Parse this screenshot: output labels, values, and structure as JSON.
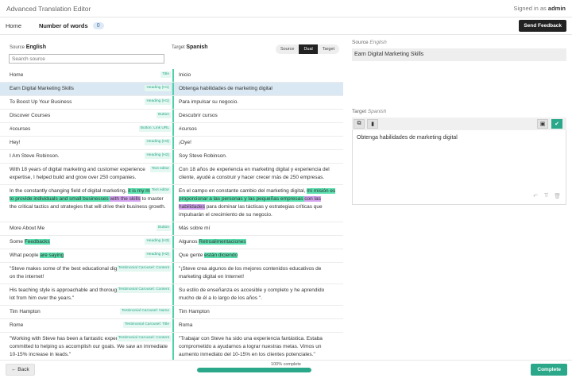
{
  "app": {
    "title": "Advanced Translation Editor",
    "signed_prefix": "Signed in as ",
    "user": "admin"
  },
  "nav": {
    "home": "Home",
    "words_label": "Number of words",
    "words_count": "0",
    "feedback": "Send Feedback"
  },
  "source": {
    "label": "Source",
    "language": "English",
    "search_placeholder": "Search source"
  },
  "target": {
    "label": "Target",
    "language": "Spanish"
  },
  "view_toggle": {
    "options": [
      "Source",
      "Dual",
      "Target"
    ],
    "selected": "Dual"
  },
  "rows": [
    {
      "src": "Home",
      "tag": "Title",
      "tgt": "Inicio"
    },
    {
      "src": "Earn Digital Marketing Skills",
      "tag": "Heading (H1)",
      "tgt": "Obtenga habilidades de marketing digital",
      "selected": true
    },
    {
      "src": "To Boost Up Your Business",
      "tag": "Heading (H1)",
      "tgt": "Para impulsar su negocio."
    },
    {
      "src": "Discover Courses",
      "tag": "Button",
      "tgt": "Descubrir cursos"
    },
    {
      "src": "#courses",
      "tag": "Button: Link URL",
      "tgt": "#cursos"
    },
    {
      "src": "Hey!",
      "tag": "Heading (H3)",
      "tgt": "¡Oye!"
    },
    {
      "src": "I Am Steve Robinson.",
      "tag": "Heading (H2)",
      "tgt": "Soy Steve Robinson."
    },
    {
      "src": "With 18 years of digital marketing and customer experience expertise, I helped build and grow over 250 companies.",
      "tag": "Text editor",
      "tgt": "Con 18 años de experiencia en marketing digital y experiencia del cliente, ayudé a construir y hacer crecer más de 250 empresas."
    },
    {
      "src_parts": [
        "In the constantly changing field of digital marketing, ",
        "it is my mission to provide individuals and small businesses ",
        "with the skills",
        " to master the critical tactics and strategies that will drive their business growth."
      ],
      "tag": "Text editor",
      "tgt_parts": [
        "En el campo en constante cambio del marketing digital, ",
        "mi misión es proporcionar a las personas y las pequeñas empresas ",
        "con las habilidades",
        " para dominar las tácticas y estrategias críticas que impulsarán el crecimiento de su negocio."
      ]
    },
    {
      "src": "More About Me",
      "tag": "Button",
      "tgt": "Más sobre mí"
    },
    {
      "src_parts": [
        "Some ",
        "Feedbacks"
      ],
      "tag": "Heading (H3)",
      "tgt_parts": [
        "Algunos ",
        "Retroalimentaciones"
      ]
    },
    {
      "src_parts": [
        "What people ",
        "are saying"
      ],
      "tag": "Heading (H2)",
      "tgt_parts": [
        "Que gente ",
        "están diciendo"
      ]
    },
    {
      "src": "\"Steve makes some of the best educational digital marketing content on the internet!",
      "tag": "Testimonial Carousel: Content",
      "tgt": "\"¡Steve crea algunos de los mejores contenidos educativos de marketing digital en Internet!"
    },
    {
      "src": "His teaching style is approachable and thorough and I've learned a lot from him over the years.\"",
      "tag": "Testimonial Carousel: Content",
      "tgt": "Su estilo de enseñanza es accesible y completo y he aprendido mucho de él a lo largo de los años \"."
    },
    {
      "src": "Tim Hampton",
      "tag": "Testimonial Carousel: Name",
      "tgt": "Tim Hampton"
    },
    {
      "src": "Rome",
      "tag": "Testimonial Carousel: Title",
      "tgt": "Roma"
    },
    {
      "src": "\"Working with Steve has been a fantastic experience. He was committed to helping us accomplish our goals. We saw an immediate 10-15% increase in leads.\"",
      "tag": "Testimonial Carousel: Content",
      "tgt": "\"Trabajar con Steve ha sido una experiencia fantástica. Estaba comprometido a ayudarnos a lograr nuestras metas. Vimos un aumento inmediato del 10-15% en los clientes potenciales.\""
    }
  ],
  "right_panel": {
    "source_label": "Source",
    "source_lang": "English",
    "source_text": "Earn Digital Marketing Skills",
    "target_label": "Target",
    "target_lang": "Spanish",
    "target_text": "Obtenga habilidades de marketing digital"
  },
  "footer": {
    "back": "← Back",
    "progress_label": "100% complete",
    "progress": 1.0,
    "complete": "Complete"
  },
  "colors": {
    "accent": "#2aa889",
    "highlight_green": "#5ce0b0",
    "highlight_purple": "#d3a3ef",
    "selected_row": "#d9e8f2"
  },
  "icons": {
    "copy": "copy-icon",
    "book": "book-icon",
    "save": "save-icon",
    "check": "check-icon",
    "undo": "undo-icon",
    "clear_format": "clear-format-icon",
    "delete": "trash-icon"
  }
}
